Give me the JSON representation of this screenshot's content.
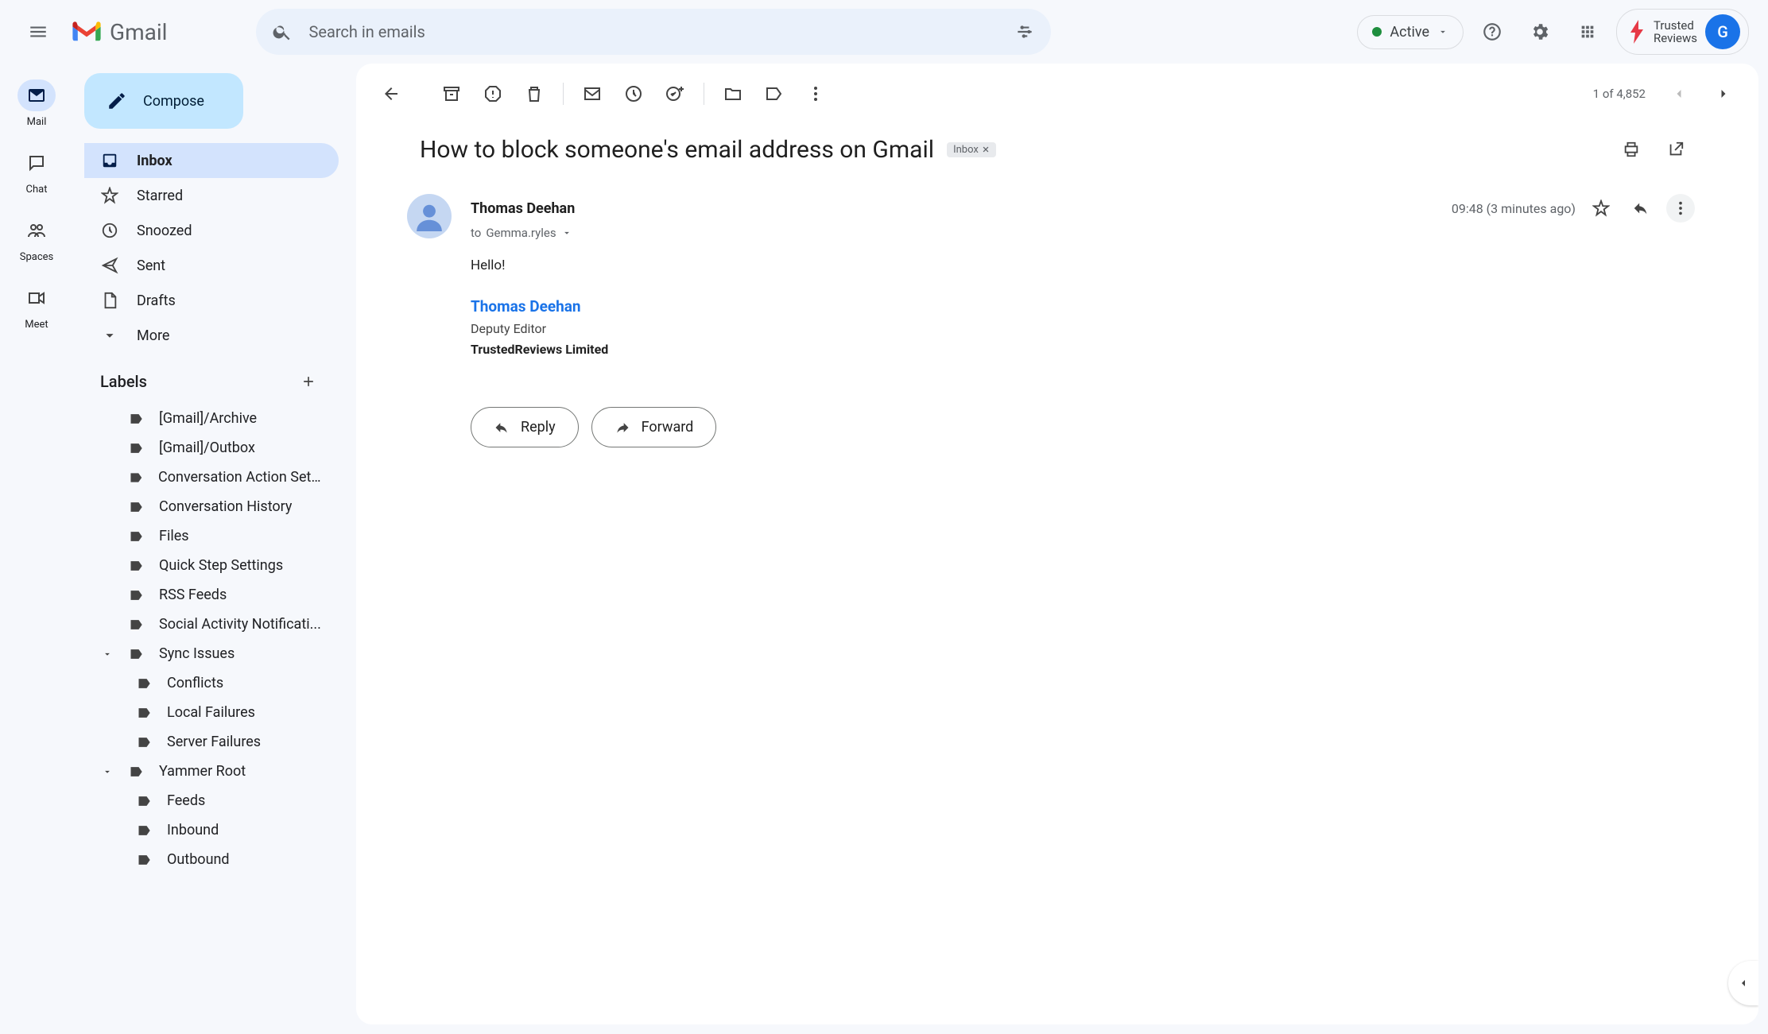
{
  "header": {
    "app_name": "Gmail",
    "search_placeholder": "Search in emails",
    "active_label": "Active",
    "brand_line1": "Trusted",
    "brand_line2": "Reviews",
    "avatar_initial": "G"
  },
  "rail": {
    "items": [
      {
        "label": "Mail"
      },
      {
        "label": "Chat"
      },
      {
        "label": "Spaces"
      },
      {
        "label": "Meet"
      }
    ]
  },
  "sidebar": {
    "compose_label": "Compose",
    "nav": [
      {
        "label": "Inbox"
      },
      {
        "label": "Starred"
      },
      {
        "label": "Snoozed"
      },
      {
        "label": "Sent"
      },
      {
        "label": "Drafts"
      },
      {
        "label": "More"
      }
    ],
    "labels_header": "Labels",
    "labels": [
      {
        "label": "[Gmail]/Archive"
      },
      {
        "label": "[Gmail]/Outbox"
      },
      {
        "label": "Conversation Action Sett..."
      },
      {
        "label": "Conversation History"
      },
      {
        "label": "Files"
      },
      {
        "label": "Quick Step Settings"
      },
      {
        "label": "RSS Feeds"
      },
      {
        "label": "Social Activity Notificati..."
      },
      {
        "label": "Sync Issues"
      },
      {
        "label": "Conflicts"
      },
      {
        "label": "Local Failures"
      },
      {
        "label": "Server Failures"
      },
      {
        "label": "Yammer Root"
      },
      {
        "label": "Feeds"
      },
      {
        "label": "Inbound"
      },
      {
        "label": "Outbound"
      }
    ]
  },
  "toolbar": {
    "counter": "1 of 4,852"
  },
  "message": {
    "subject": "How to block someone's email address on Gmail",
    "chip": "Inbox",
    "sender_name": "Thomas Deehan",
    "to_prefix": "to ",
    "to_name": "Gemma.ryles",
    "time": "09:48 (3 minutes ago)",
    "body_greeting": "Hello!",
    "sig_name": "Thomas Deehan",
    "sig_title": "Deputy Editor",
    "sig_company": "TrustedReviews Limited",
    "reply_label": "Reply",
    "forward_label": "Forward"
  }
}
